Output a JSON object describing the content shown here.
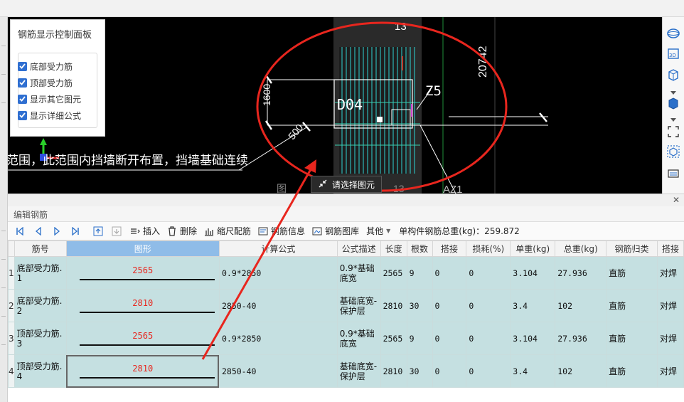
{
  "panel": {
    "title": "钢筋显示控制面板",
    "options": [
      {
        "label": "底部受力筋",
        "checked": true
      },
      {
        "label": "顶部受力筋",
        "checked": true
      },
      {
        "label": "显示其它图元",
        "checked": true
      },
      {
        "label": "显示详细公式",
        "checked": true
      }
    ]
  },
  "cad": {
    "label_13_top": "13",
    "label_13_bottom": "13",
    "label_20742": "20742",
    "label_d04": "D04",
    "label_z5": "Z5",
    "label_1600": "1600",
    "label_500": "500",
    "label_az1": "AZ1",
    "label_tu": "图",
    "note_text": "范围，此范围内挡墙断开布置，挡墙基础连续"
  },
  "select_button": {
    "label": "请选择图元"
  },
  "editor": {
    "title": "编辑钢筋"
  },
  "toolbar": {
    "insert": "插入",
    "delete": "删除",
    "scale_rebar": "缩尺配筋",
    "rebar_info": "钢筋信息",
    "rebar_library": "钢筋图库",
    "other": "其他",
    "total_label": "单构件钢筋总重(kg)：259.872"
  },
  "table": {
    "headers": [
      "筋号",
      "图形",
      "计算公式",
      "公式描述",
      "长度",
      "根数",
      "搭接",
      "损耗(%)",
      "单重(kg)",
      "总重(kg)",
      "钢筋归类",
      "搭接"
    ],
    "rows": [
      {
        "num": "1",
        "name": "底部受力筋.1",
        "shape": "2565",
        "formula": "0.9*2850",
        "desc": "0.9*基础底宽",
        "length": "2565",
        "count": "9",
        "lap": "0",
        "loss": "0",
        "unit_w": "3.104",
        "total_w": "27.936",
        "category": "直筋",
        "lap_type": "对焊"
      },
      {
        "num": "2",
        "name": "底部受力筋.2",
        "shape": "2810",
        "formula": "2850-40",
        "desc": "基础底宽-保护层",
        "length": "2810",
        "count": "30",
        "lap": "0",
        "loss": "0",
        "unit_w": "3.4",
        "total_w": "102",
        "category": "直筋",
        "lap_type": "对焊"
      },
      {
        "num": "3",
        "name": "顶部受力筋.3",
        "shape": "2565",
        "formula": "0.9*2850",
        "desc": "0.9*基础底宽",
        "length": "2565",
        "count": "9",
        "lap": "0",
        "loss": "0",
        "unit_w": "3.104",
        "total_w": "27.936",
        "category": "直筋",
        "lap_type": "对焊"
      },
      {
        "num": "4",
        "name": "顶部受力筋.4",
        "shape": "2810",
        "formula": "2850-40",
        "desc": "基础底宽-保护层",
        "length": "2810",
        "count": "30",
        "lap": "0",
        "loss": "0",
        "unit_w": "3.4",
        "total_w": "102",
        "category": "直筋",
        "lap_type": "对焊"
      }
    ]
  },
  "colors": {
    "annotation": "#e8261e",
    "rebar": "#2fd4d4",
    "row_bg": "#c5e0e1",
    "header_selected": "#8fbce8",
    "checkbox": "#2f6fd1"
  }
}
